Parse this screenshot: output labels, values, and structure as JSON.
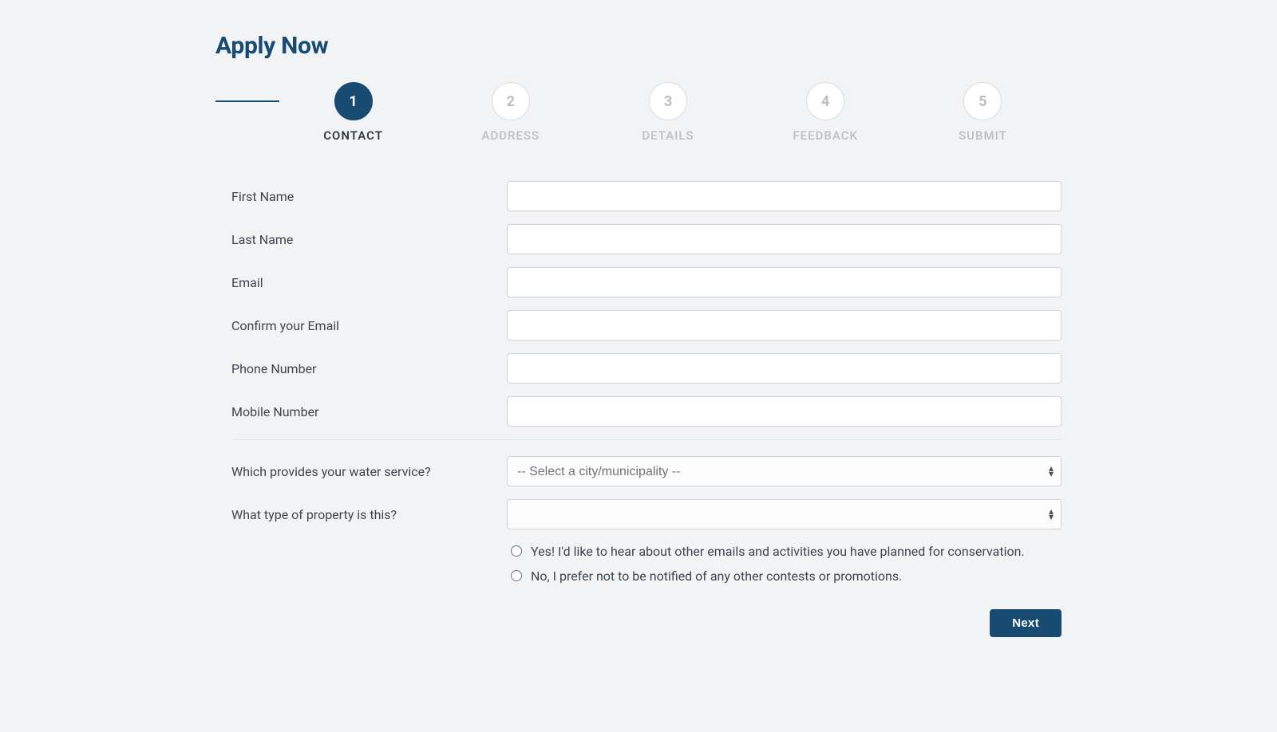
{
  "title": "Apply Now",
  "stepper": [
    {
      "num": "1",
      "label": "CONTACT",
      "active": true
    },
    {
      "num": "2",
      "label": "ADDRESS",
      "active": false
    },
    {
      "num": "3",
      "label": "DETAILS",
      "active": false
    },
    {
      "num": "4",
      "label": "FEEDBACK",
      "active": false
    },
    {
      "num": "5",
      "label": "SUBMIT",
      "active": false
    }
  ],
  "fields": {
    "first_name": {
      "label": "First Name",
      "value": ""
    },
    "last_name": {
      "label": "Last Name",
      "value": ""
    },
    "email": {
      "label": "Email",
      "value": ""
    },
    "confirm_email": {
      "label": "Confirm your Email",
      "value": ""
    },
    "phone": {
      "label": "Phone Number",
      "value": ""
    },
    "mobile": {
      "label": "Mobile Number",
      "value": ""
    },
    "water_service": {
      "label": "Which provides your water service?",
      "placeholder": "-- Select a city/municipality --",
      "value": ""
    },
    "property_type": {
      "label": "What type of property is this?",
      "placeholder": "",
      "value": ""
    }
  },
  "opt_in": {
    "yes": "Yes! I'd like to hear about other emails and activities you have planned for conservation.",
    "no": "No, I prefer not to be notified of any other contests or promotions."
  },
  "buttons": {
    "next": "Next"
  },
  "colors": {
    "accent": "#184b71",
    "muted": "#b9bfc5"
  }
}
